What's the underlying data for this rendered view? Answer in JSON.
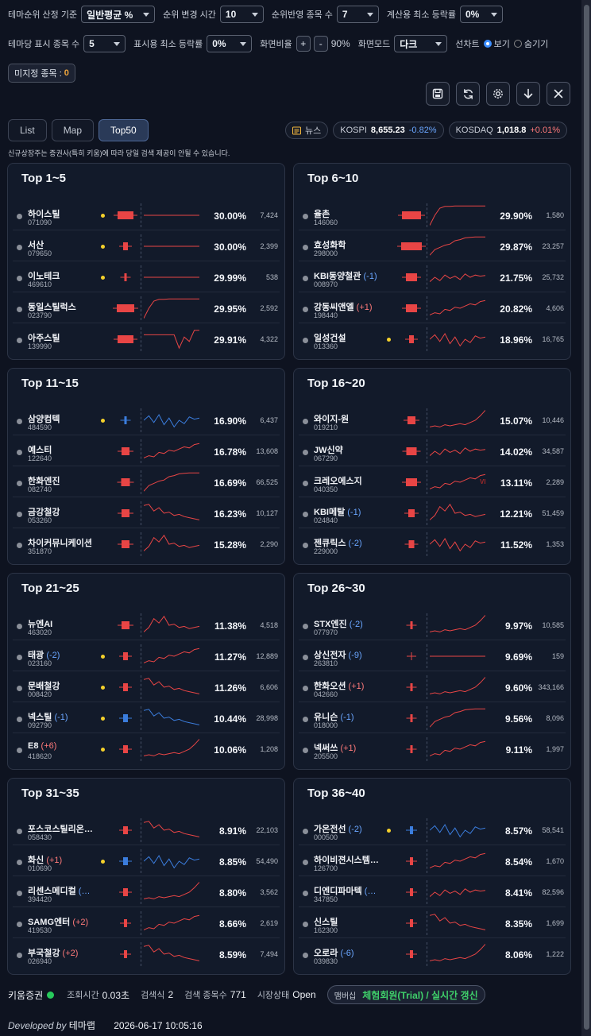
{
  "settings": {
    "rank_basis": {
      "label": "테마순위 산정 기준",
      "value": "일반평균 %"
    },
    "rank_change_time": {
      "label": "순위 변경 시간",
      "value": "10"
    },
    "rank_stock_count": {
      "label": "순위반영 종목 수",
      "value": "7"
    },
    "min_rise_calc": {
      "label": "계산용 최소 등락률",
      "value": "0%"
    },
    "display_count": {
      "label": "테마당 표시 종목 수",
      "value": "5"
    },
    "min_rise_display": {
      "label": "표시용 최소 등락률",
      "value": "0%"
    },
    "zoom": {
      "label": "화면비율",
      "plus": "+",
      "minus": "-",
      "value": "90%"
    },
    "mode": {
      "label": "화면모드",
      "value": "다크"
    },
    "linechart": {
      "label": "선차트",
      "show": "보기",
      "hide": "숨기기"
    },
    "unassigned": {
      "label": "미지정 종목 :",
      "count": "0"
    }
  },
  "tabs": [
    "List",
    "Map",
    "Top50"
  ],
  "active_tab": "Top50",
  "market": {
    "news": "뉴스",
    "kospi": {
      "name": "KOSPI",
      "value": "8,655.23",
      "change": "-0.82%"
    },
    "kosdaq": {
      "name": "KOSDAQ",
      "value": "1,018.8",
      "change": "+0.01%"
    }
  },
  "notice": "신규상장주는 증권사(특히 키움)에 따라 당일 검색 제공이 안될 수 있습니다.",
  "panels": [
    {
      "title": "Top 1~5",
      "rows": [
        {
          "name": "하이스틸",
          "code": "071090",
          "pct": "30.00%",
          "vol": "7,424"
        },
        {
          "name": "서산",
          "code": "079650",
          "pct": "30.00%",
          "vol": "2,399"
        },
        {
          "name": "이노테크",
          "code": "469610",
          "pct": "29.99%",
          "vol": "538"
        },
        {
          "name": "동일스틸럭스",
          "code": "023790",
          "pct": "29.95%",
          "vol": "2,592"
        },
        {
          "name": "아주스틸",
          "code": "139990",
          "pct": "29.91%",
          "vol": "4,322"
        }
      ]
    },
    {
      "title": "Top 6~10",
      "rows": [
        {
          "name": "율촌",
          "code": "146060",
          "pct": "29.90%",
          "vol": "1,580"
        },
        {
          "name": "효성화학",
          "code": "298000",
          "pct": "29.87%",
          "vol": "23,257"
        },
        {
          "name": "KBI동양철관",
          "change": "(-1)",
          "code": "008970",
          "pct": "21.75%",
          "vol": "25,732"
        },
        {
          "name": "강동씨앤엘",
          "change": "(+1)",
          "code": "198440",
          "pct": "20.82%",
          "vol": "4,606"
        },
        {
          "name": "일성건설",
          "code": "013360",
          "pct": "18.96%",
          "vol": "16,765"
        }
      ]
    },
    {
      "title": "Top 11~15",
      "rows": [
        {
          "name": "삼양컴텍",
          "code": "484590",
          "pct": "16.90%",
          "vol": "6,437"
        },
        {
          "name": "예스티",
          "code": "122640",
          "pct": "16.78%",
          "vol": "13,608"
        },
        {
          "name": "한화엔진",
          "code": "082740",
          "pct": "16.69%",
          "vol": "66,525"
        },
        {
          "name": "금강철강",
          "code": "053260",
          "pct": "16.23%",
          "vol": "10,127"
        },
        {
          "name": "차이커뮤니케이션",
          "code": "351870",
          "pct": "15.28%",
          "vol": "2,290"
        }
      ]
    },
    {
      "title": "Top 16~20",
      "rows": [
        {
          "name": "와이지-원",
          "code": "019210",
          "pct": "15.07%",
          "vol": "10,446"
        },
        {
          "name": "JW신약",
          "code": "067290",
          "pct": "14.02%",
          "vol": "34,587"
        },
        {
          "name": "크레오에스지",
          "code": "040350",
          "vi": "VI",
          "pct": "13.11%",
          "vol": "2,289"
        },
        {
          "name": "KBI메탈",
          "change": "(-1)",
          "code": "024840",
          "pct": "12.21%",
          "vol": "51,459"
        },
        {
          "name": "젠큐릭스",
          "change": "(-2)",
          "code": "229000",
          "pct": "11.52%",
          "vol": "1,353"
        }
      ]
    },
    {
      "title": "Top 21~25",
      "rows": [
        {
          "name": "뉴엔AI",
          "code": "463020",
          "pct": "11.38%",
          "vol": "4,518"
        },
        {
          "name": "태광",
          "change": "(-2)",
          "code": "023160",
          "pct": "11.27%",
          "vol": "12,889"
        },
        {
          "name": "문배철강",
          "code": "008420",
          "pct": "11.26%",
          "vol": "6,606"
        },
        {
          "name": "넥스틸",
          "change": "(-1)",
          "code": "092790",
          "pct": "10.44%",
          "vol": "28,998"
        },
        {
          "name": "E8",
          "change": "(+6)",
          "code": "418620",
          "pct": "10.06%",
          "vol": "1,208"
        }
      ]
    },
    {
      "title": "Top 26~30",
      "rows": [
        {
          "name": "STX엔진",
          "change": "(-2)",
          "code": "077970",
          "pct": "9.97%",
          "vol": "10,585"
        },
        {
          "name": "상신전자",
          "change": "(-9)",
          "code": "263810",
          "pct": "9.69%",
          "vol": "159"
        },
        {
          "name": "한화오션",
          "change": "(+1)",
          "code": "042660",
          "pct": "9.60%",
          "vol": "343,166"
        },
        {
          "name": "유니슨",
          "change": "(-1)",
          "code": "018000",
          "pct": "9.56%",
          "vol": "8,096"
        },
        {
          "name": "넥써쓰",
          "change": "(+1)",
          "code": "205500",
          "pct": "9.11%",
          "vol": "1,997"
        }
      ]
    },
    {
      "title": "Top 31~35",
      "rows": [
        {
          "name": "포스코스틸리온…",
          "code": "058430",
          "pct": "8.91%",
          "vol": "22,103"
        },
        {
          "name": "화신",
          "change": "(+1)",
          "code": "010690",
          "pct": "8.85%",
          "vol": "54,490"
        },
        {
          "name": "리센스메디컬",
          "change": "(…",
          "code": "394420",
          "pct": "8.80%",
          "vol": "3,562"
        },
        {
          "name": "SAMG엔터",
          "change": "(+2)",
          "code": "419530",
          "pct": "8.66%",
          "vol": "2,619"
        },
        {
          "name": "부국철강",
          "change": "(+2)",
          "code": "026940",
          "pct": "8.59%",
          "vol": "7,494"
        }
      ]
    },
    {
      "title": "Top 36~40",
      "rows": [
        {
          "name": "가온전선",
          "change": "(-2)",
          "code": "000500",
          "pct": "8.57%",
          "vol": "58,541"
        },
        {
          "name": "하이비젼시스템…",
          "code": "126700",
          "pct": "8.54%",
          "vol": "1,670"
        },
        {
          "name": "디엔디파마텍",
          "change": "(…",
          "code": "347850",
          "pct": "8.41%",
          "vol": "82,596"
        },
        {
          "name": "신스틸",
          "code": "162300",
          "pct": "8.35%",
          "vol": "1,699"
        },
        {
          "name": "오로라",
          "change": "(-6)",
          "code": "039830",
          "pct": "8.06%",
          "vol": "1,222"
        }
      ]
    }
  ],
  "footer": {
    "broker": "키움증권",
    "query_time_label": "조회시간",
    "query_time": "0.03초",
    "search_label": "검색식",
    "search_count": "2",
    "stocks_label": "검색 종목수",
    "stocks_count": "771",
    "market_label": "시장상태",
    "market_status": "Open",
    "membership_label": "맴버십",
    "membership": "체험회원(Trial) / 실시간 갱신",
    "developed_by": "Developed by",
    "developer": "테마랩",
    "timestamp": "2026-06-17 10:05:16"
  },
  "colors": {
    "up": "#e84545",
    "down": "#3b7ddd",
    "status_on": "#27c95b",
    "accent": "#3d8eff"
  }
}
